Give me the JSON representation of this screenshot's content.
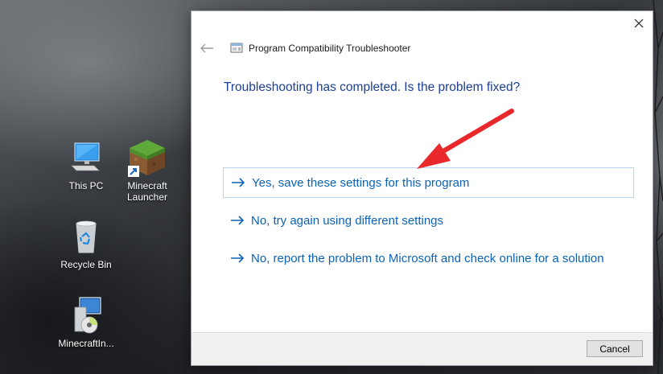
{
  "desktop": {
    "icons": [
      {
        "label": "This PC",
        "icon": "computer-icon"
      },
      {
        "label": "Minecraft Launcher",
        "icon": "minecraft-grass-block-icon"
      },
      {
        "label": "Recycle Bin",
        "icon": "recycle-bin-icon"
      },
      {
        "label": "MinecraftIn...",
        "icon": "installer-icon"
      }
    ]
  },
  "dialog": {
    "title": "Program Compatibility Troubleshooter",
    "question": "Troubleshooting has completed.  Is the problem fixed?",
    "options": [
      {
        "label": "Yes, save these settings for this program"
      },
      {
        "label": "No, try again using different settings"
      },
      {
        "label": "No, report the problem to Microsoft and check online for a solution"
      }
    ],
    "cancel_label": "Cancel"
  },
  "colors": {
    "question_text": "#1c3f94",
    "option_link": "#0a63b8",
    "annotation_arrow": "#e8282b"
  }
}
